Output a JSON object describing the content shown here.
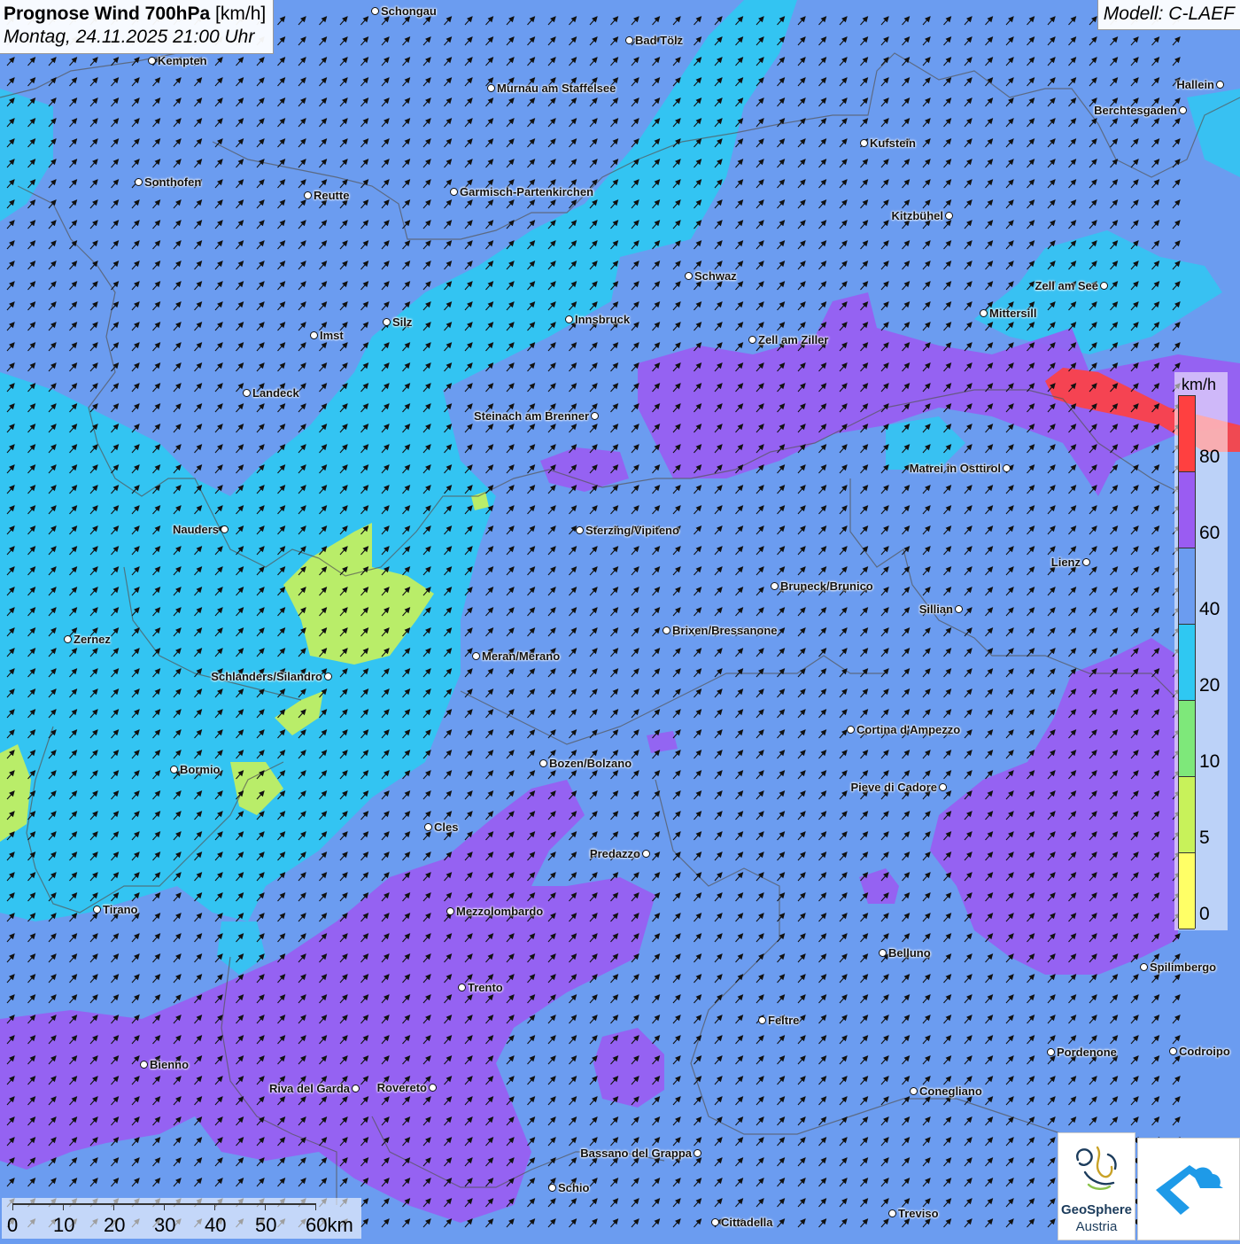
{
  "header": {
    "title_bold": "Prognose Wind 700hPa",
    "title_unit": "[km/h]",
    "datetime": "Montag, 24.11.2025 21:00 Uhr"
  },
  "model": {
    "label": "Modell: C-LAEF"
  },
  "legend": {
    "unit": "km/h",
    "items": [
      {
        "label": "80",
        "color": "#ff4040"
      },
      {
        "label": "60",
        "color": "#9a5cf2"
      },
      {
        "label": "40",
        "color": "#6b9cf0"
      },
      {
        "label": "20",
        "color": "#2fc8f2"
      },
      {
        "label": "10",
        "color": "#7ee87a"
      },
      {
        "label": "5",
        "color": "#c8f25a"
      },
      {
        "label": "0",
        "color": "#ffff66"
      }
    ]
  },
  "scale_bar": {
    "labels": [
      "0",
      "10",
      "20",
      "30",
      "40",
      "50",
      "60km"
    ]
  },
  "colors": {
    "background_40_60": "#6b9cf0",
    "field_20_40": "#2fc8f2",
    "field_60_80": "#9a5cf2",
    "field_80": "#ff4040",
    "field_5_10": "#c8f25a"
  },
  "wind_direction": "south-west to north-east arrows",
  "cities": [
    {
      "name": "Schongau"
    },
    {
      "name": "Bad Tölz"
    },
    {
      "name": "Kempten"
    },
    {
      "name": "Murnau am Staffelsee"
    },
    {
      "name": "Hallein"
    },
    {
      "name": "Berchtesgaden"
    },
    {
      "name": "Kufstein"
    },
    {
      "name": "Sonthofen"
    },
    {
      "name": "Reutte"
    },
    {
      "name": "Garmisch-Partenkirchen"
    },
    {
      "name": "Kitzbühel"
    },
    {
      "name": "Schwaz"
    },
    {
      "name": "Zell am See"
    },
    {
      "name": "Mittersill"
    },
    {
      "name": "Innsbruck"
    },
    {
      "name": "Silz"
    },
    {
      "name": "Imst"
    },
    {
      "name": "Zell am Ziller"
    },
    {
      "name": "Landeck"
    },
    {
      "name": "Steinach am Brenner"
    },
    {
      "name": "Matrei in Osttirol"
    },
    {
      "name": "Nauders"
    },
    {
      "name": "Sterzing/Vipiteno"
    },
    {
      "name": "Lienz"
    },
    {
      "name": "Bruneck/Brunico"
    },
    {
      "name": "Sillian"
    },
    {
      "name": "Brixen/Bressanone"
    },
    {
      "name": "Zernez"
    },
    {
      "name": "Meran/Merano"
    },
    {
      "name": "Schlanders/Silandro"
    },
    {
      "name": "Cortina d'Ampezzo"
    },
    {
      "name": "Bozen/Bolzano"
    },
    {
      "name": "Bormio"
    },
    {
      "name": "Pieve di Cadore"
    },
    {
      "name": "Cles"
    },
    {
      "name": "Predazzo"
    },
    {
      "name": "Tirano"
    },
    {
      "name": "Mezzolombardo"
    },
    {
      "name": "Belluno"
    },
    {
      "name": "Spilimbergo"
    },
    {
      "name": "Trento"
    },
    {
      "name": "Feltre"
    },
    {
      "name": "Pordenone"
    },
    {
      "name": "Codroipo"
    },
    {
      "name": "Bienno"
    },
    {
      "name": "Riva del Garda"
    },
    {
      "name": "Rovereto"
    },
    {
      "name": "Conegliano"
    },
    {
      "name": "Bassano del Grappa"
    },
    {
      "name": "Schio"
    },
    {
      "name": "Treviso"
    },
    {
      "name": "Cittadella"
    }
  ],
  "logos": {
    "geosphere_name": "GeoSphere",
    "geosphere_sub": "Austria"
  }
}
